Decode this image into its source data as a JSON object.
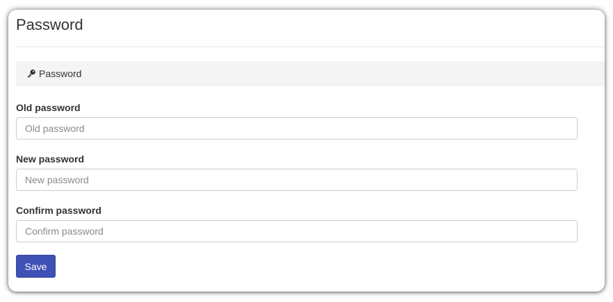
{
  "page": {
    "title": "Password"
  },
  "section": {
    "icon": "key-icon",
    "label": "Password"
  },
  "form": {
    "old_password": {
      "label": "Old password",
      "placeholder": "Old password",
      "value": ""
    },
    "new_password": {
      "label": "New password",
      "placeholder": "New password",
      "value": ""
    },
    "confirm_password": {
      "label": "Confirm password",
      "placeholder": "Confirm password",
      "value": ""
    },
    "save_label": "Save"
  },
  "colors": {
    "primary": "#3f51b5",
    "section_background": "#f4f4f4",
    "text": "#333333"
  }
}
